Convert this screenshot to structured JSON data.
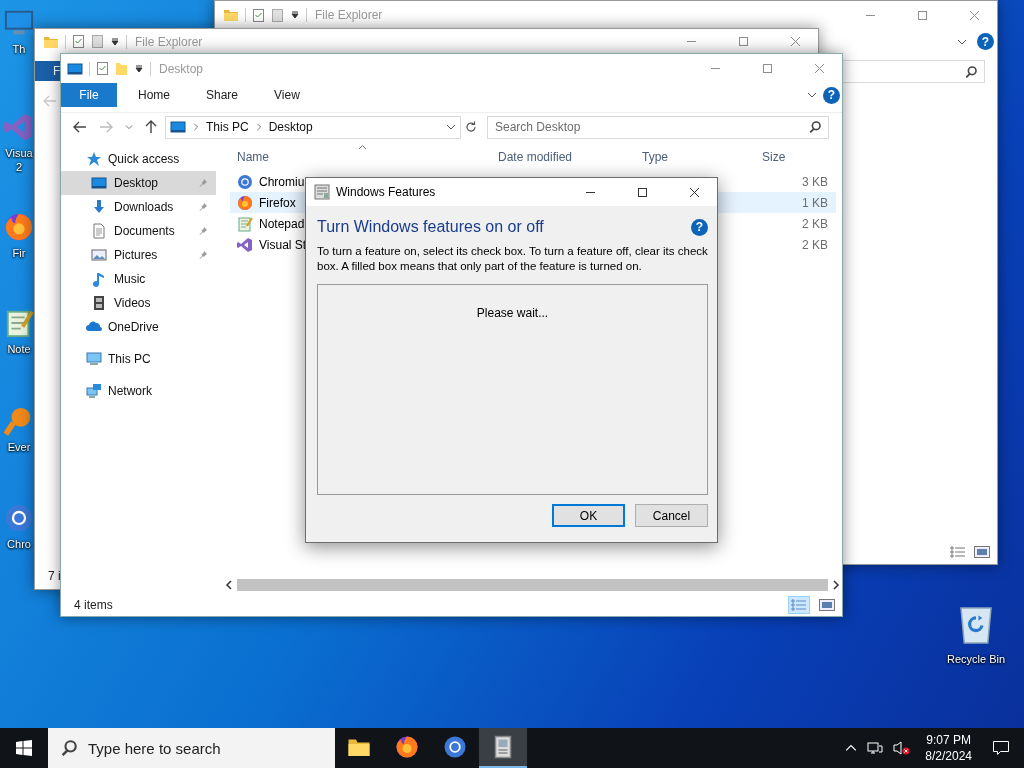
{
  "desktop": {
    "icons": [
      {
        "kind": "pc",
        "label": "Th"
      },
      {
        "kind": "vs",
        "label": "Visua 2"
      },
      {
        "kind": "firefox",
        "label": "Fir"
      },
      {
        "kind": "notepad",
        "label": "Note"
      },
      {
        "kind": "everything",
        "label": "Ever"
      },
      {
        "kind": "chromium",
        "label": "Chro"
      }
    ],
    "recycle_bin": {
      "label": "Recycle Bin"
    }
  },
  "back_window": {
    "title": "File Explorer",
    "help": "?"
  },
  "middle_window": {
    "title": "File Explorer",
    "file_tab": "F",
    "status": "7 i"
  },
  "explorer": {
    "title": "Desktop",
    "tabs": [
      {
        "label": "File",
        "selected": true
      },
      {
        "label": "Home",
        "selected": false
      },
      {
        "label": "Share",
        "selected": false
      },
      {
        "label": "View",
        "selected": false
      }
    ],
    "help": "?",
    "address": [
      "This PC",
      "Desktop"
    ],
    "search": {
      "placeholder": "Search Desktop"
    },
    "nav": [
      {
        "kind": "star",
        "label": "Quick access",
        "selected": false,
        "pinned": false,
        "children": [
          {
            "kind": "desktop",
            "label": "Desktop",
            "selected": true,
            "pinned": true
          },
          {
            "kind": "download",
            "label": "Downloads",
            "selected": false,
            "pinned": true
          },
          {
            "kind": "document",
            "label": "Documents",
            "selected": false,
            "pinned": true
          },
          {
            "kind": "pictures",
            "label": "Pictures",
            "selected": false,
            "pinned": true
          },
          {
            "kind": "music",
            "label": "Music",
            "selected": false,
            "pinned": false
          },
          {
            "kind": "videos",
            "label": "Videos",
            "selected": false,
            "pinned": false
          }
        ]
      },
      {
        "kind": "onedrive",
        "label": "OneDrive",
        "selected": false,
        "pinned": false
      },
      {
        "kind": "thispc",
        "label": "This PC",
        "selected": false,
        "pinned": false
      },
      {
        "kind": "network",
        "label": "Network",
        "selected": false,
        "pinned": false
      }
    ],
    "columns": [
      "Name",
      "Date modified",
      "Type",
      "Size"
    ],
    "rows": [
      {
        "kind": "chromium",
        "name": "Chromiu",
        "size": "3 KB",
        "selected": false
      },
      {
        "kind": "firefox",
        "name": "Firefox",
        "size": "1 KB",
        "selected": true
      },
      {
        "kind": "notepad",
        "name": "Notepad",
        "size": "2 KB",
        "selected": false
      },
      {
        "kind": "vs",
        "name": "Visual St",
        "size": "2 KB",
        "selected": false
      }
    ],
    "status": "4 items"
  },
  "dialog": {
    "title": "Windows Features",
    "heading": "Turn Windows features on or off",
    "help": "?",
    "description": "To turn a feature on, select its check box. To turn a feature off, clear its check box. A filled box means that only part of the feature is turned on.",
    "message": "Please wait...",
    "buttons": [
      {
        "label": "OK",
        "default": true
      },
      {
        "label": "Cancel",
        "default": false
      }
    ]
  },
  "taskbar": {
    "search": {
      "placeholder": "Type here to search"
    },
    "apps": [
      {
        "kind": "folder",
        "selected": false
      },
      {
        "kind": "firefox",
        "selected": false
      },
      {
        "kind": "chromium",
        "selected": false
      },
      {
        "kind": "package",
        "selected": true
      }
    ],
    "time": "9:07 PM",
    "date": "8/2/2024"
  }
}
